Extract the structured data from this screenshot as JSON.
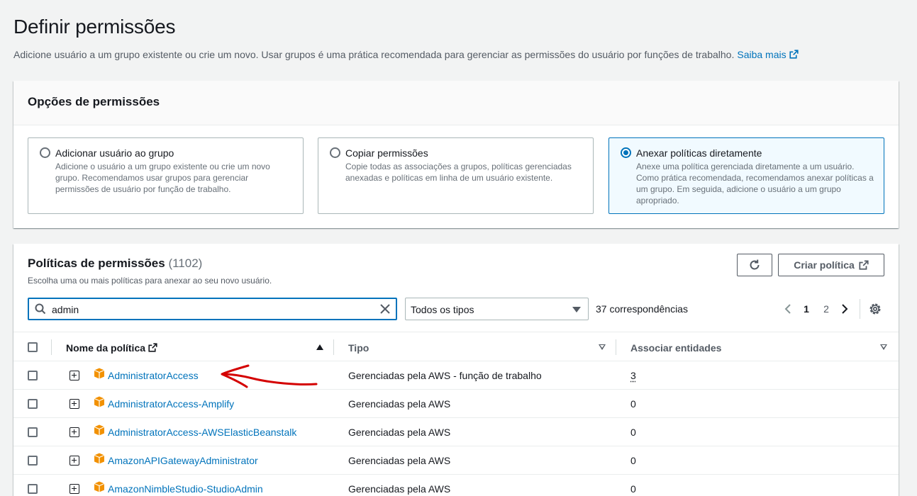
{
  "page": {
    "title": "Definir permissões",
    "description": "Adicione usuário a um grupo existente ou crie um novo. Usar grupos é uma prática recomendada para gerenciar as permissões do usuário por funções de trabalho.",
    "learn_more": "Saiba mais"
  },
  "options_panel": {
    "title": "Opções de permissões",
    "tiles": [
      {
        "title": "Adicionar usuário ao grupo",
        "description": "Adicione o usuário a um grupo existente ou crie um novo grupo. Recomendamos usar grupos para gerenciar permissões de usuário por função de trabalho.",
        "selected": false
      },
      {
        "title": "Copiar permissões",
        "description": "Copie todas as associações a grupos, políticas gerenciadas anexadas e políticas em linha de um usuário existente.",
        "selected": false
      },
      {
        "title": "Anexar políticas diretamente",
        "description": "Anexe uma política gerenciada diretamente a um usuário. Como prática recomendada, recomendamos anexar políticas a um grupo. Em seguida, adicione o usuário a um grupo apropriado.",
        "selected": true
      }
    ]
  },
  "policies_panel": {
    "title": "Políticas de permissões",
    "count": "(1102)",
    "subtitle": "Escolha uma ou mais políticas para anexar ao seu novo usuário.",
    "create_button": "Criar política",
    "search": {
      "value": "admin"
    },
    "type_filter": {
      "selected": "Todos os tipos"
    },
    "matches": "37 correspondências",
    "pagination": {
      "pages": [
        "1",
        "2"
      ],
      "current": "1"
    },
    "columns": {
      "name": "Nome da política",
      "type": "Tipo",
      "entities": "Associar entidades"
    },
    "rows": [
      {
        "name": "AdministratorAccess",
        "type": "Gerenciadas pela AWS - função de trabalho",
        "entities": "3"
      },
      {
        "name": "AdministratorAccess-Amplify",
        "type": "Gerenciadas pela AWS",
        "entities": "0"
      },
      {
        "name": "AdministratorAccess-AWSElasticBeanstalk",
        "type": "Gerenciadas pela AWS",
        "entities": "0"
      },
      {
        "name": "AmazonAPIGatewayAdministrator",
        "type": "Gerenciadas pela AWS",
        "entities": "0"
      },
      {
        "name": "AmazonNimbleStudio-StudioAdmin",
        "type": "Gerenciadas pela AWS",
        "entities": "0"
      }
    ]
  },
  "colors": {
    "link": "#0073bb",
    "policy_icon": "#f29100",
    "annotation_arrow": "#d40000"
  },
  "icons": {
    "external": "external-link-icon",
    "refresh": "refresh-icon",
    "search": "search-icon",
    "clear": "close-icon",
    "settings": "gear-icon",
    "policy": "policy-cube-icon"
  }
}
